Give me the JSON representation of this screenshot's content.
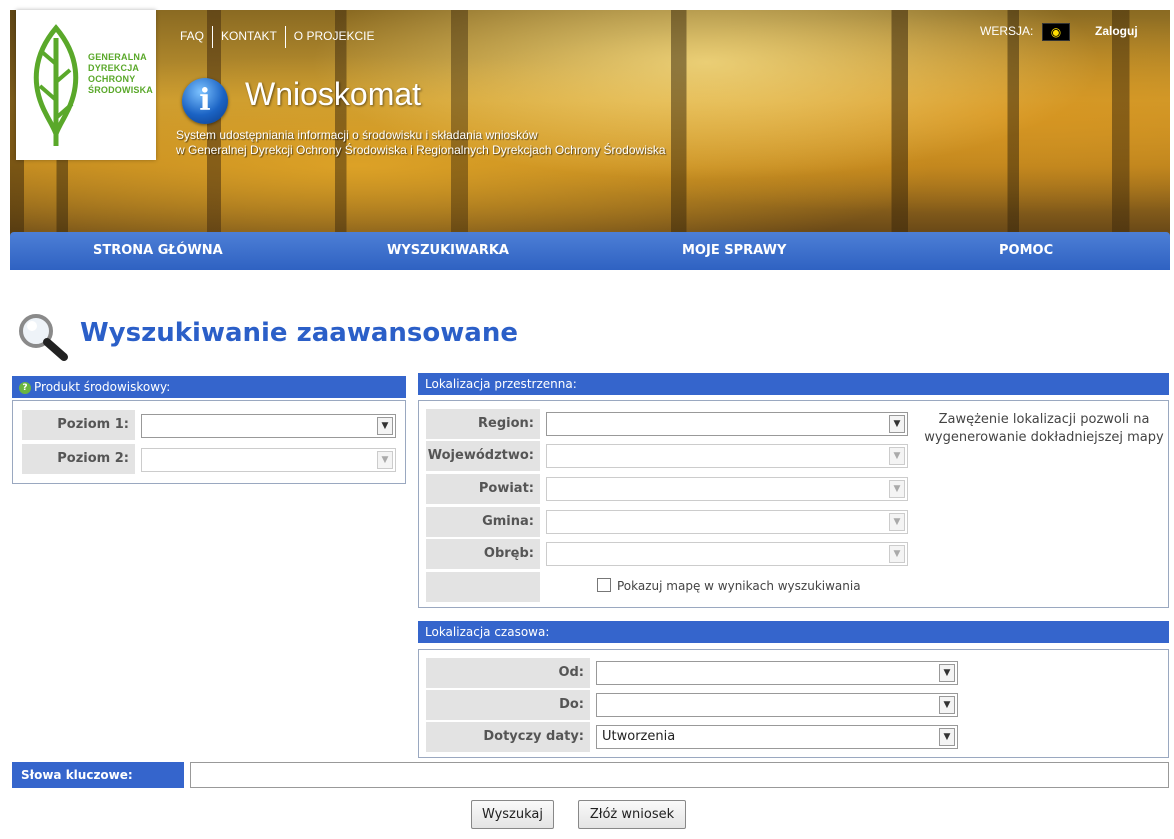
{
  "header": {
    "logo_lines": [
      "GENERALNA",
      "DYREKCJA",
      "OCHRONY",
      "ŚRODOWISKA"
    ],
    "top_links": [
      "FAQ",
      "KONTAKT",
      "O PROJEKCIE"
    ],
    "version_label": "WERSJA:",
    "login": "Zaloguj",
    "app_title": "Wnioskomat",
    "subtitle_lines": [
      "System udostępniania informacji o środowisku i składania wniosków",
      "w Generalnej Dyrekcji Ochrony Środowiska i Regionalnych Dyrekcjach Ochrony Środowiska"
    ]
  },
  "nav": [
    "STRONA GŁÓWNA",
    "WYSZUKIWARKA",
    "MOJE SPRAWY",
    "POMOC"
  ],
  "page_title": "Wyszukiwanie zaawansowane",
  "product": {
    "heading": "Produkt środowiskowy:",
    "fields": [
      {
        "label": "Poziom 1:",
        "value": ""
      },
      {
        "label": "Poziom 2:",
        "value": ""
      }
    ]
  },
  "spatial": {
    "heading": "Lokalizacja przestrzenna:",
    "fields": [
      {
        "label": "Region:",
        "value": ""
      },
      {
        "label": "Województwo:",
        "value": ""
      },
      {
        "label": "Powiat:",
        "value": ""
      },
      {
        "label": "Gmina:",
        "value": ""
      },
      {
        "label": "Obręb:",
        "value": ""
      }
    ],
    "hint": "Zawężenie lokalizacji pozwoli na wygenerowanie dokładniejszej mapy",
    "show_map_label": "Pokazuj mapę w wynikach wyszukiwania",
    "show_map_checked": false
  },
  "temporal": {
    "heading": "Lokalizacja czasowa:",
    "fields": [
      {
        "label": "Od:",
        "value": ""
      },
      {
        "label": "Do:",
        "value": ""
      },
      {
        "label": "Dotyczy daty:",
        "value": "Utworzenia"
      }
    ]
  },
  "keywords": {
    "label": "Słowa kluczowe:",
    "value": ""
  },
  "buttons": {
    "search": "Wyszukaj",
    "submit": "Złóż wniosek"
  },
  "colors": {
    "accent": "#3565cc",
    "title": "#2b5fc8",
    "logo_green": "#5aa82a"
  }
}
